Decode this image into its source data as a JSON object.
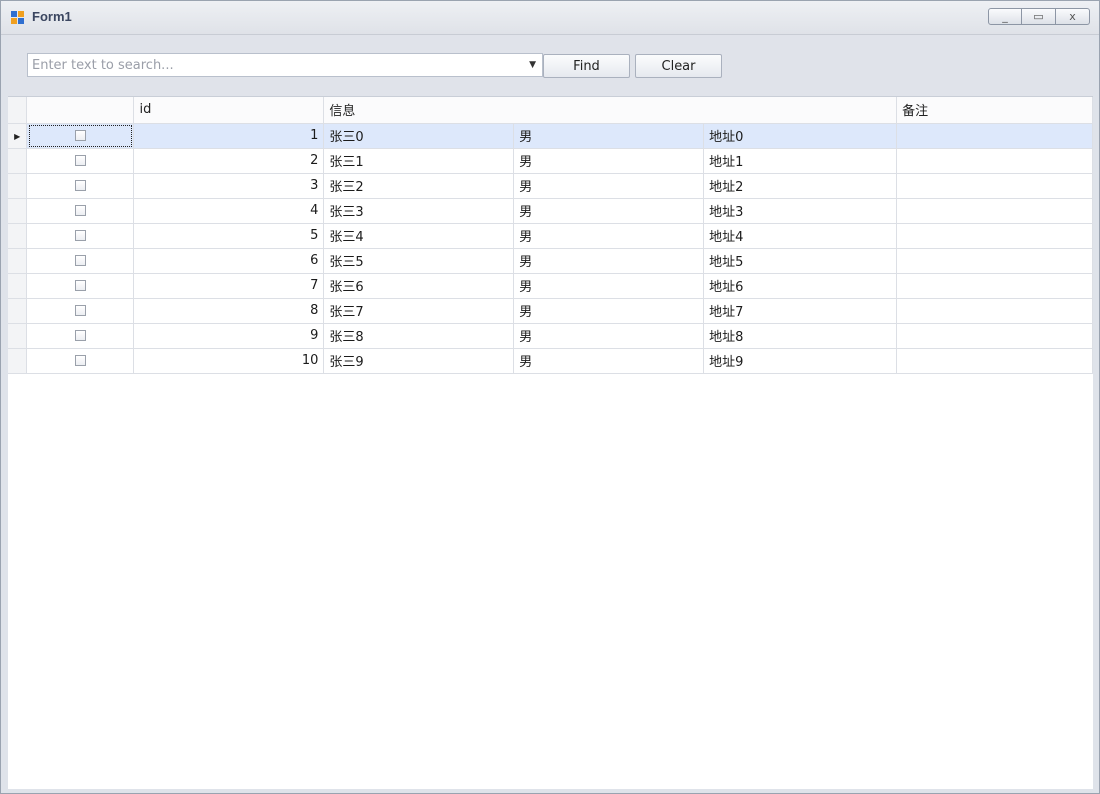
{
  "window": {
    "title": "Form1"
  },
  "window_controls": [
    {
      "name": "minimize",
      "icon": "minimize-icon",
      "glyph": "_"
    },
    {
      "name": "maximize",
      "icon": "maximize-icon",
      "glyph": "▭"
    },
    {
      "name": "close",
      "icon": "close-icon",
      "glyph": "x"
    }
  ],
  "toolbar": {
    "search_placeholder": "Enter text to search...",
    "search_value": "",
    "find_label": "Find",
    "clear_label": "Clear"
  },
  "grid": {
    "headers": {
      "checkbox": "",
      "id": "id",
      "info": "信息",
      "remark": "备注"
    },
    "selected_row": 0,
    "rows": [
      {
        "checked": false,
        "id": "1",
        "name": "张三0",
        "gender": "男",
        "address": "地址0",
        "remark": ""
      },
      {
        "checked": false,
        "id": "2",
        "name": "张三1",
        "gender": "男",
        "address": "地址1",
        "remark": ""
      },
      {
        "checked": false,
        "id": "3",
        "name": "张三2",
        "gender": "男",
        "address": "地址2",
        "remark": ""
      },
      {
        "checked": false,
        "id": "4",
        "name": "张三3",
        "gender": "男",
        "address": "地址3",
        "remark": ""
      },
      {
        "checked": false,
        "id": "5",
        "name": "张三4",
        "gender": "男",
        "address": "地址4",
        "remark": ""
      },
      {
        "checked": false,
        "id": "6",
        "name": "张三5",
        "gender": "男",
        "address": "地址5",
        "remark": ""
      },
      {
        "checked": false,
        "id": "7",
        "name": "张三6",
        "gender": "男",
        "address": "地址6",
        "remark": ""
      },
      {
        "checked": false,
        "id": "8",
        "name": "张三7",
        "gender": "男",
        "address": "地址7",
        "remark": ""
      },
      {
        "checked": false,
        "id": "9",
        "name": "张三8",
        "gender": "男",
        "address": "地址8",
        "remark": ""
      },
      {
        "checked": false,
        "id": "10",
        "name": "张三9",
        "gender": "男",
        "address": "地址9",
        "remark": ""
      }
    ]
  },
  "colors": {
    "selection": "#dde8fb",
    "chrome": "#dfe3ea",
    "title_text": "#3b4660",
    "app_icon_blue": "#2f6fd0",
    "app_icon_orange": "#f0a020"
  }
}
